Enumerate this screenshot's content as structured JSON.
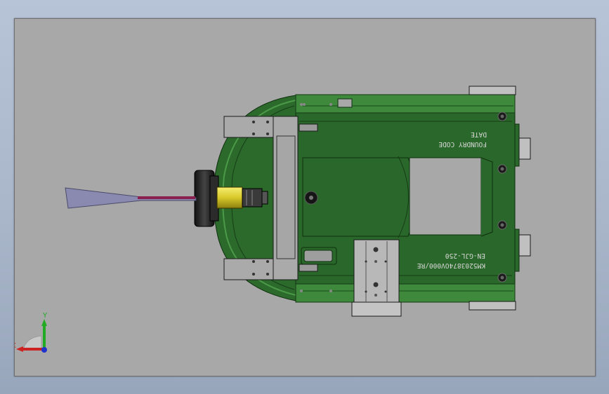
{
  "viewport": {
    "background": "#a8a8a8"
  },
  "part": {
    "body_color": "#2c6a2c",
    "rim_color": "#3f8a3c",
    "bracket_color": "#a9a9a9",
    "engravings": {
      "foundry_code": "FOUNDRY  CODE",
      "date": "DATE",
      "part_number": "KM5203874OV000/RE",
      "grade": "EN-GJL-250"
    }
  },
  "triad": {
    "x_label": "X",
    "y_label": "Y",
    "x_color": "#cc2222",
    "y_color": "#22aa22",
    "z_color": "#2233cc"
  }
}
